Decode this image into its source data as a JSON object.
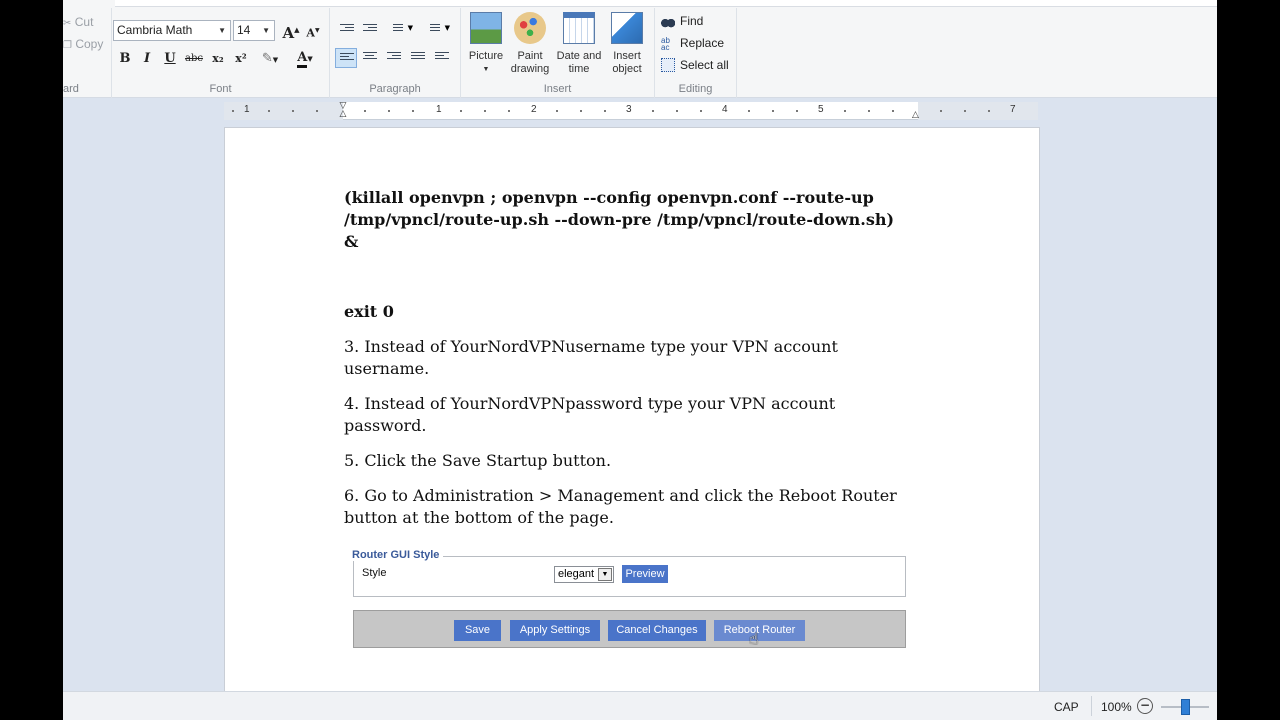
{
  "clipboard": {
    "cut_label": "Cut",
    "copy_label": "Copy",
    "group_label": "ard"
  },
  "font": {
    "family": "Cambria Math",
    "size": "14",
    "group_label": "Font",
    "bold": "B",
    "italic": "I",
    "underline": "U",
    "strike": "abc",
    "subscript": "x₂",
    "superscript": "x²",
    "grow": "A",
    "shrink": "A",
    "color_letter": "A"
  },
  "paragraph": {
    "group_label": "Paragraph"
  },
  "insert": {
    "group_label": "Insert",
    "picture_label": "Picture",
    "paint_label": "Paint drawing",
    "datetime_label": "Date and time",
    "object_label": "Insert object"
  },
  "editing": {
    "group_label": "Editing",
    "find_label": "Find",
    "replace_label": "Replace",
    "select_all_label": "Select all"
  },
  "ruler": {
    "numbers": [
      "1",
      "1",
      "2",
      "3",
      "4",
      "5",
      "7"
    ]
  },
  "document": {
    "command_line1": "(killall openvpn ; openvpn --config openvpn.conf --route-up",
    "command_line2": "/tmp/vpncl/route-up.sh --down-pre /tmp/vpncl/route-down.sh)",
    "command_line3": "&",
    "exit_line": "exit 0",
    "step3": "3. Instead of YourNordVPNusername type your VPN account\nusername.",
    "step4": "4. Instead of YourNordVPNpassword type your VPN account\npassword.",
    "step5": "5. Click the Save Startup button.",
    "step6": "6. Go to Administration > Management and click the Reboot Router\nbutton at the bottom of the page."
  },
  "router_gui": {
    "legend": "Router GUI Style",
    "style_label": "Style",
    "style_value": "elegant",
    "preview_label": "Preview",
    "buttons": [
      "Save",
      "Apply Settings",
      "Cancel Changes",
      "Reboot Router"
    ]
  },
  "status": {
    "caps": "CAP",
    "zoom": "100%",
    "zoom_level": 0.5
  }
}
